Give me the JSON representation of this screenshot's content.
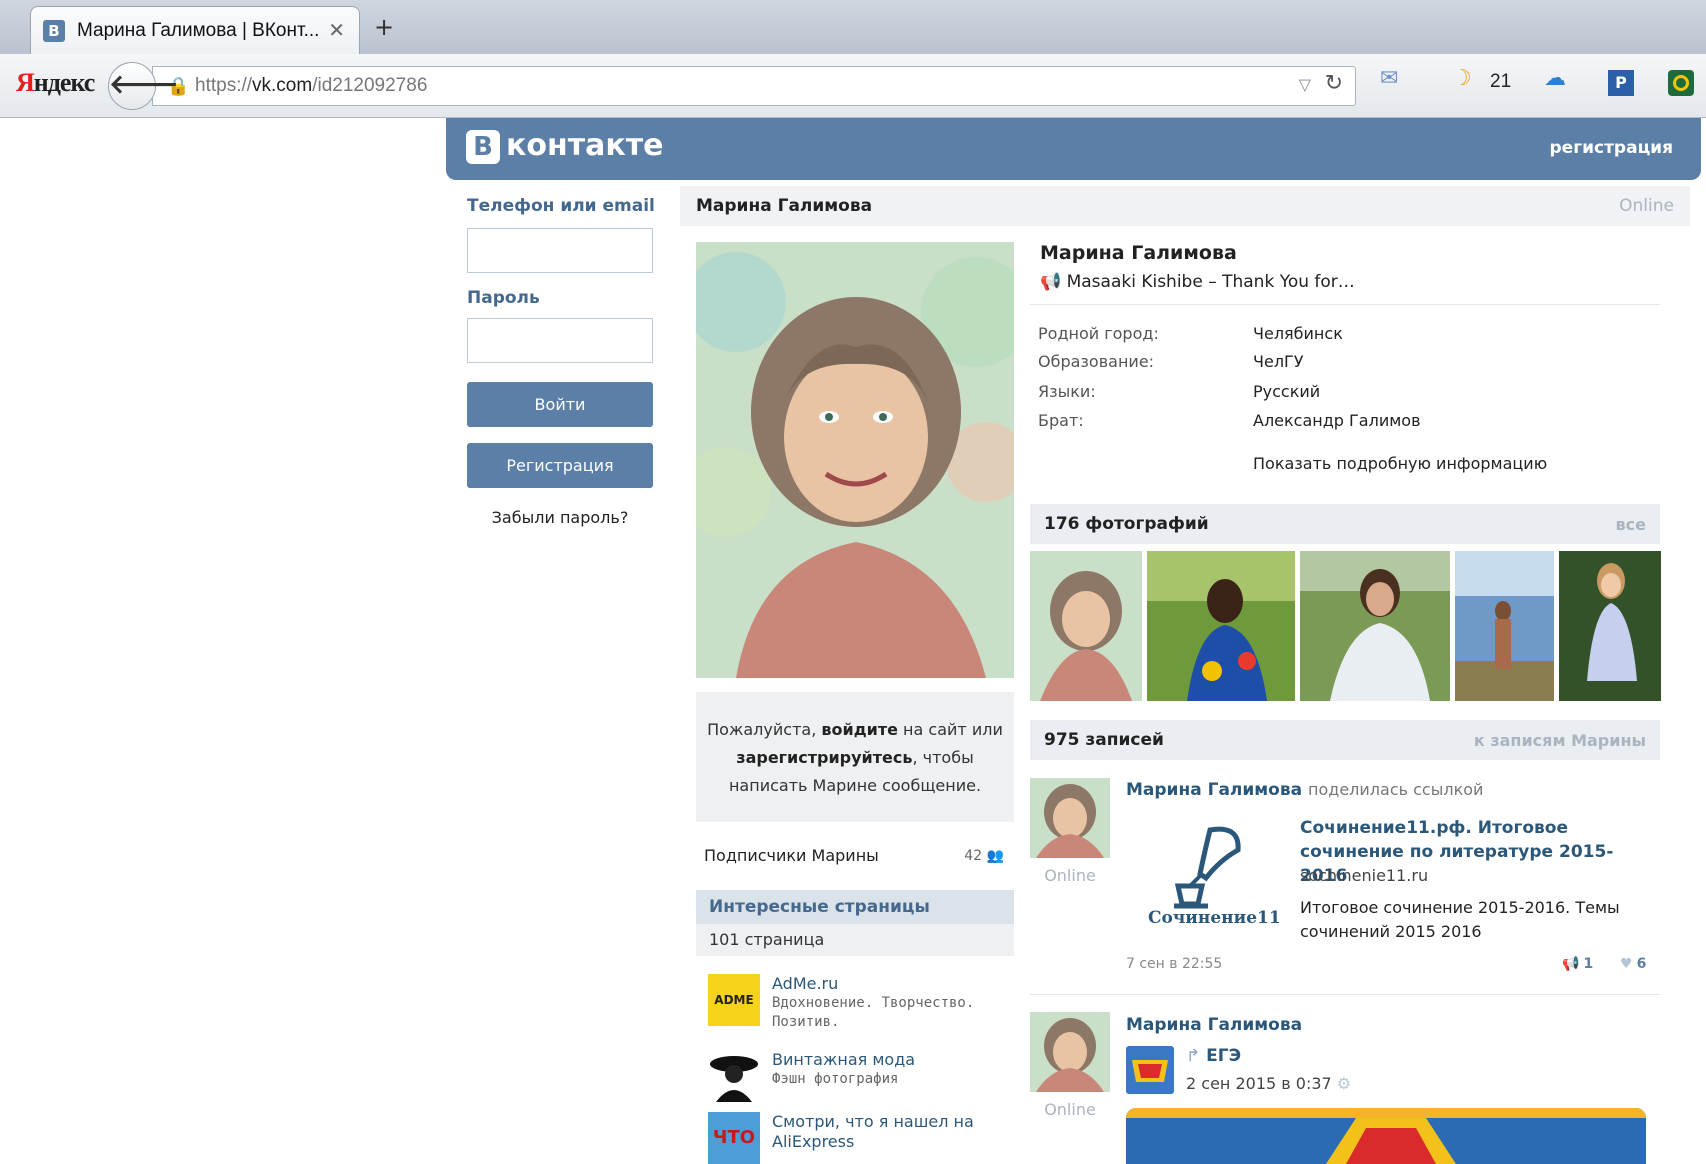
{
  "browser": {
    "tab_title": "Марина Галимова | ВКонт...",
    "tab_favicon": "В",
    "url_prefix": "https://",
    "url_domain": "vk.com",
    "url_path": "/id212092786",
    "yandex_logo": "Я",
    "yandex_logo_rest": "ндекс",
    "toolbar_count": "21"
  },
  "vk": {
    "logo_letter": "В",
    "logo_text": "контакте",
    "register_link": "регистрация"
  },
  "login": {
    "phone_label": "Телефон или email",
    "password_label": "Пароль",
    "login_button": "Войти",
    "register_button": "Регистрация",
    "forgot_link": "Забыли пароль?"
  },
  "profile": {
    "name": "Марина Галимова",
    "online": "Online",
    "status": "Masaaki Kishibe – Thank You for…",
    "info": [
      {
        "label": "Родной город:",
        "value": "Челябинск"
      },
      {
        "label": "Образование:",
        "value": "ЧелГУ"
      },
      {
        "label": "Языки:",
        "value": "Русский"
      },
      {
        "label": "Брат:",
        "value": "Александр Галимов"
      }
    ],
    "show_more": "Показать подробную информацию",
    "message_box": {
      "part1": "Пожалуйста, ",
      "login_bold": "войдите",
      "part2": " на сайт или",
      "register_bold": "зарегистрируйтесь",
      "part3": ", чтобы",
      "line3": "написать Марине сообщение."
    },
    "subscribers_label": "Подписчики Марины",
    "subscribers_count": "42",
    "interesting_title": "Интересные страницы",
    "interesting_count": "101 страница",
    "pages": [
      {
        "title": "AdMe.ru",
        "desc": "Вдохновение. Творчество. Позитив.",
        "thumb_label": "ADME"
      },
      {
        "title": "Винтажная мода",
        "desc": "Фэшн фотография",
        "thumb_label": ""
      },
      {
        "title": "Смотри, что я нашел на AliExpress",
        "desc": "",
        "thumb_label": "ЧТО"
      }
    ]
  },
  "photos": {
    "title": "176 фотографий",
    "all_link": "все"
  },
  "wall": {
    "title": "975 записей",
    "link": "к записям Марины",
    "post1": {
      "author": "Марина Галимова",
      "action": "поделилась ссылкой",
      "online": "Online",
      "link_logo_name": "Сочинение11",
      "link_title": "Сочинение11.рф. Итоговое сочинение по литературе 2015-2016",
      "link_domain": "sochinenie11.ru",
      "link_desc": "Итоговое сочинение 2015-2016. Темы сочинений 2015 2016",
      "date": "7 сен в 22:55",
      "reposts": "1",
      "likes": "6"
    },
    "post2": {
      "author": "Марина Галимова",
      "online": "Online",
      "repost_name": "ЕГЭ",
      "repost_date": "2 сен 2015 в 0:37"
    }
  }
}
